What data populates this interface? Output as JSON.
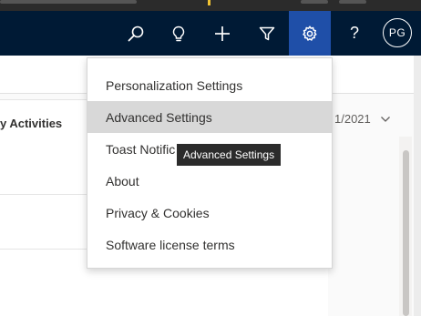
{
  "navbar": {
    "search_icon": "search-icon",
    "lightbulb_icon": "lightbulb-icon",
    "plus_icon": "plus-icon",
    "filter_icon": "filter-icon",
    "settings_icon": "gear-icon",
    "help_label": "?",
    "avatar_initials": "PG",
    "background_color": "#001a35",
    "active_color": "#1f4fa8"
  },
  "content": {
    "section_heading": "y Activities",
    "date_text": "1/2021"
  },
  "settings_menu": {
    "items": [
      {
        "label": "Personalization Settings"
      },
      {
        "label": "Advanced Settings"
      },
      {
        "label": "Toast Notific"
      },
      {
        "label": "About"
      },
      {
        "label": "Privacy & Cookies"
      },
      {
        "label": "Software license terms"
      }
    ],
    "hovered_index": 1
  },
  "tooltip": {
    "text": "Advanced Settings"
  }
}
